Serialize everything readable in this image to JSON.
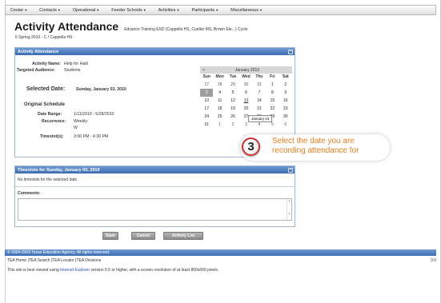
{
  "nav": {
    "items": [
      {
        "label": "Cestar"
      },
      {
        "label": "Contacts"
      },
      {
        "label": "Operational"
      },
      {
        "label": "Feeder Schools"
      },
      {
        "label": "Activities"
      },
      {
        "label": "Participants"
      },
      {
        "label": "Miscellaneous"
      }
    ]
  },
  "page": {
    "title": "Activity Attendance",
    "subtitle": "Edvance Training ESD (Cappella HS, Cuellar MS, Brown Ele...) Cycle",
    "breadcrumb": "6 Spring 2010 - C / Cappella HS"
  },
  "activity_panel": {
    "header": "Activity Attendance",
    "activity_name_label": "Activity Name:",
    "activity_name": "Help for Haiti",
    "targeted_audience_label": "Targeted Audience:",
    "targeted_audience": "Students",
    "selected_date_label": "Selected Date:",
    "selected_date": "Sunday, January 03, 2010",
    "original_schedule_label": "Original Schedule",
    "date_range_label": "Date Range:",
    "date_range": "1/11/2010 - 5/28/2010",
    "recurrence_label": "Recurrence:",
    "recurrence_value": "Weekly:",
    "recurrence_day": "W",
    "timeslots_label": "Timeslot(s):",
    "timeslots_value": "3:00 PM - 4:30 PM"
  },
  "calendar": {
    "prev": "<",
    "month": "January 2010",
    "days_of_week": [
      "Sun",
      "Mon",
      "Tue",
      "Wed",
      "Thu",
      "Fri",
      "Sat"
    ],
    "weeks": [
      [
        "27",
        "28",
        "29",
        "30",
        "31",
        "1",
        "2"
      ],
      [
        "3",
        "4",
        "5",
        "6",
        "7",
        "8",
        "9"
      ],
      [
        "10",
        "11",
        "12",
        "13",
        "14",
        "15",
        "16"
      ],
      [
        "17",
        "18",
        "19",
        "20",
        "21",
        "22",
        "23"
      ],
      [
        "24",
        "25",
        "26",
        "27",
        "28",
        "29",
        "30"
      ],
      [
        "31",
        "1",
        "2",
        "3",
        "4",
        "5",
        "6"
      ]
    ],
    "tooltip": "January 13"
  },
  "callout": {
    "number": "3",
    "text": "Select the date you are recording attendance for"
  },
  "timeslots_panel": {
    "header": "Timeslots for Sunday, January 03, 2010",
    "no_timeslots": "No timeslots for the selected date.",
    "comments_label": "Comments:"
  },
  "buttons": {
    "save": "Save",
    "cancel": "Cancel",
    "activity_list": "Activity List"
  },
  "footer": {
    "copyright": "© 2004-2009 Texas Education Agency. All rights reserved.",
    "links": "TEA Home  |TEA Search  |TEA Locator  |TEA Divisions",
    "version": "3.0",
    "note_before": "This site is best viewed using ",
    "note_link": "Internet Explorer",
    "note_after": " version 5.5 or higher, with a screen resolution of at least 800x600 pixels."
  },
  "colors": {
    "panel_header": "#3b6db3",
    "callout_text": "#e87d1e",
    "callout_ring": "#cc3333"
  }
}
